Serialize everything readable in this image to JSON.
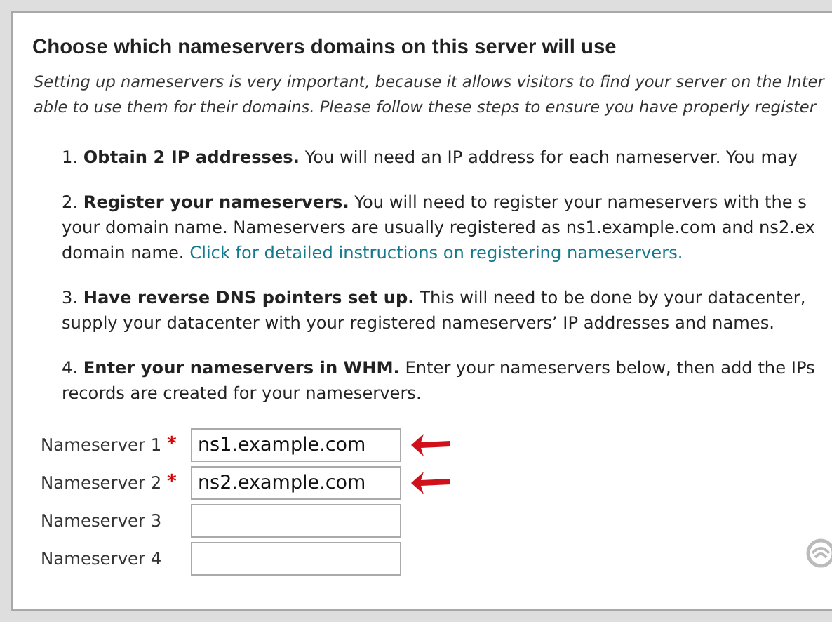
{
  "heading": "Choose which nameservers domains on this server will use",
  "intro_lines": [
    "Setting up nameservers is very important, because it allows visitors to find your server on the Inter",
    "able to use them for their domains. Please follow these steps to ensure you have properly register"
  ],
  "steps": [
    {
      "lines": [
        "1. **Obtain 2 IP addresses.** You will need an IP address for each nameserver. You may"
      ]
    },
    {
      "lines": [
        "2. **Register your nameservers.** You will need to register your nameservers with the s",
        "your domain name. Nameservers are usually registered as ns1.example.com and ns2.ex",
        "domain name."
      ],
      "link": "Click for detailed instructions on registering nameservers."
    },
    {
      "lines": [
        "3. **Have reverse DNS pointers set up.** This will need to be done by your datacenter,",
        "supply your datacenter with your registered nameservers’ IP addresses and names."
      ]
    },
    {
      "lines": [
        "4. **Enter your nameservers in WHM.** Enter your nameservers below, then add the IPs",
        "records are created for your nameservers."
      ]
    }
  ],
  "nameservers": [
    {
      "label": "Nameserver 1",
      "required_mark": "*",
      "value": "ns1.example.com",
      "highlighted": true
    },
    {
      "label": "Nameserver 2",
      "required_mark": "*",
      "value": "ns2.example.com",
      "highlighted": true
    },
    {
      "label": "Nameserver 3",
      "highlighted": false
    },
    {
      "label": "Nameserver 4",
      "highlighted": false
    }
  ]
}
